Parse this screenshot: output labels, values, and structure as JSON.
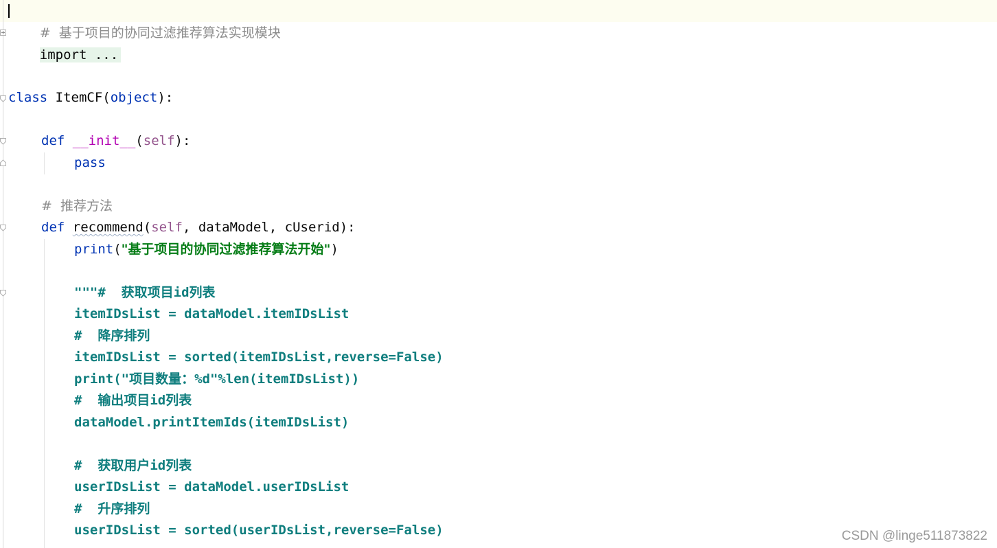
{
  "code": {
    "line1_comment": "#  基于项目的协同过滤推荐算法实现模块",
    "line2_import": "import ...",
    "line3_class_kw": "class",
    "line3_class_name": " ItemCF(",
    "line3_base": "object",
    "line3_end": "):",
    "line4_def": "def",
    "line4_init": "__init__",
    "line4_open": "(",
    "line4_self": "self",
    "line4_close": "):",
    "line5_pass": "pass",
    "line6_comment": "#  推荐方法",
    "line7_def": "def",
    "line7_name": "recommend",
    "line7_open": "(",
    "line7_self": "self",
    "line7_rest": ", dataModel, cUserid):",
    "line8_print": "print",
    "line8_open": "(",
    "line8_str": "\"基于项目的协同过滤推荐算法开始\"",
    "line8_close": ")",
    "doc_lines": [
      "\"\"\"#  获取项目id列表",
      "itemIDsList = dataModel.itemIDsList",
      "#  降序排列",
      "itemIDsList = sorted(itemIDsList,reverse=False)",
      "print(\"项目数量：%d\"%len(itemIDsList))",
      "#  输出项目id列表",
      "dataModel.printItemIds(itemIDsList)",
      "#  获取用户id列表",
      "userIDsList = dataModel.userIDsList",
      "#  升序排列",
      "userIDsList = sorted(userIDsList,reverse=False)"
    ]
  },
  "watermark": "CSDN @linge511873822",
  "colors": {
    "keyword": "#0033b3",
    "dunder": "#b200b2",
    "self": "#94558d",
    "comment": "#8c8c8c",
    "string": "#067d17",
    "docstring": "#0f7e7e"
  }
}
